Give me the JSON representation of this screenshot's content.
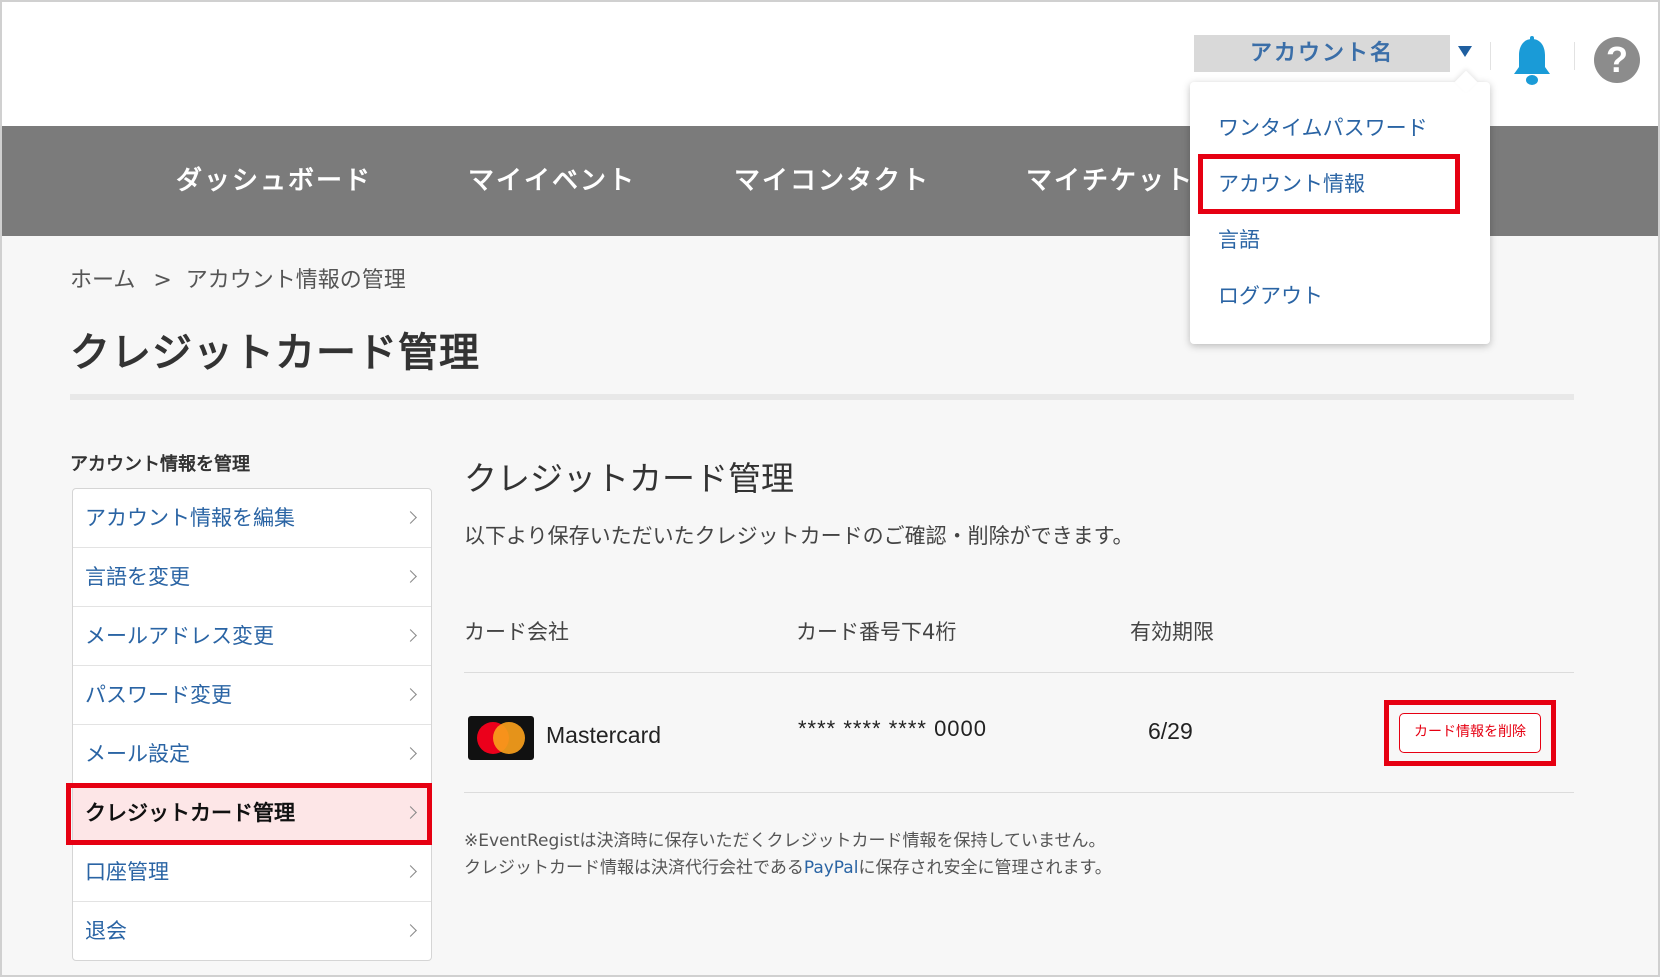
{
  "header": {
    "account_name": "アカウント名"
  },
  "account_menu": {
    "items": [
      "ワンタイムパスワード",
      "アカウント情報",
      "言語",
      "ログアウト"
    ]
  },
  "nav": {
    "items": [
      "ダッシュボード",
      "マイイベント",
      "マイコンタクト",
      "マイチケット"
    ]
  },
  "breadcrumb": {
    "home": "ホーム",
    "separator": ">",
    "current": "アカウント情報の管理"
  },
  "page_title": "クレジットカード管理",
  "sidebar": {
    "heading": "アカウント情報を管理",
    "items": [
      {
        "label": "アカウント情報を編集"
      },
      {
        "label": "言語を変更"
      },
      {
        "label": "メールアドレス変更"
      },
      {
        "label": "パスワード変更"
      },
      {
        "label": "メール設定"
      },
      {
        "label": "クレジットカード管理",
        "active": true
      },
      {
        "label": "口座管理"
      },
      {
        "label": "退会"
      }
    ]
  },
  "main": {
    "title": "クレジットカード管理",
    "description": "以下より保存いただいたクレジットカードのご確認・削除ができます。",
    "table": {
      "headers": [
        "カード会社",
        "カード番号下4桁",
        "有効期限"
      ],
      "rows": [
        {
          "brand": "Mastercard",
          "number": "**** **** **** 0000",
          "expiry": "6/29",
          "action": "カード情報を削除"
        }
      ]
    },
    "note_line1": "※EventRegistは決済時に保存いただくクレジットカード情報を保持していません。",
    "note_line2_pre": "クレジットカード情報は決済代行会社である",
    "note_link": "PayPal",
    "note_line2_post": "に保存され安全に管理されます。"
  },
  "colors": {
    "accent_red": "#e60012",
    "link_blue": "#2a64a4",
    "nav_gray": "#7b7b7b",
    "bell_blue": "#1a9bd7"
  }
}
